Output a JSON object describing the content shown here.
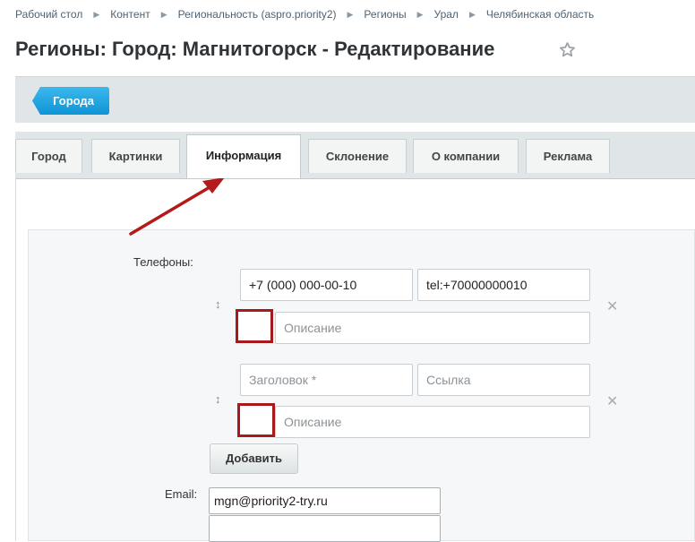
{
  "breadcrumbs": [
    "Рабочий стол",
    "Контент",
    "Региональность (aspro.priority2)",
    "Регионы",
    "Урал",
    "Челябинская область"
  ],
  "breadcrumb_separator": "▶",
  "page_title": "Регионы: Город: Магнитогорск - Редактирование",
  "toolbar": {
    "back_label": "Города"
  },
  "tabs": [
    "Город",
    "Картинки",
    "Информация",
    "Склонение",
    "О компании",
    "Реклама"
  ],
  "active_tab": "Информация",
  "phones": {
    "label": "Телефоны:",
    "rows": [
      {
        "phone_value": "+7 (000) 000-00-10",
        "link_value": "tel:+70000000010",
        "desc_placeholder": "Описание"
      },
      {
        "phone_placeholder": "Заголовок *",
        "link_placeholder": "Ссылка",
        "desc_placeholder": "Описание"
      }
    ],
    "add_label": "Добавить"
  },
  "email": {
    "label": "Email:",
    "value": "mgn@priority2-try.ru"
  },
  "icons": {
    "star": "star-icon",
    "drag": "drag-handle-icon",
    "remove": "close-icon",
    "arrow": "annotation-arrow-icon"
  },
  "colors": {
    "back_button": "#1aa1e0",
    "annotation": "#b51a1a"
  }
}
